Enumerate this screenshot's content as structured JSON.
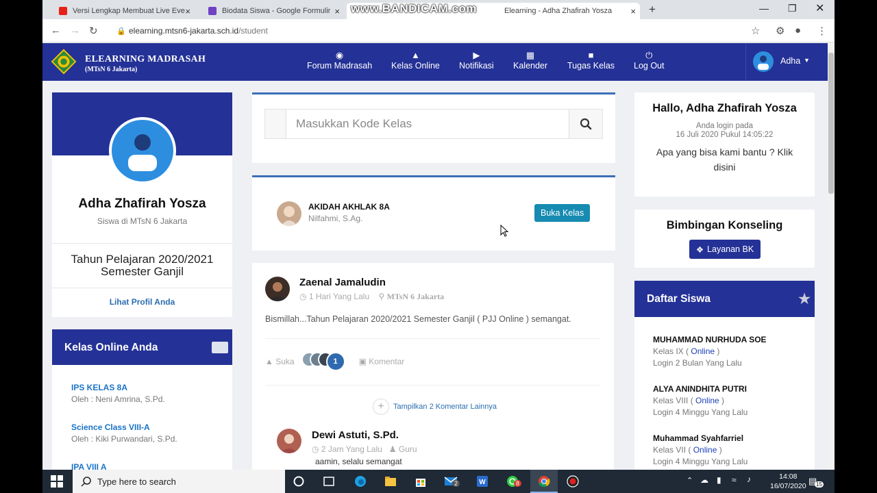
{
  "browser": {
    "tabs": [
      {
        "title": "Versi Lengkap Membuat Live Eve",
        "close": "×"
      },
      {
        "title": "Biodata Siswa - Google Formulir",
        "close": "×"
      },
      {
        "title": "Elearning - Adha Zhafirah Yosza",
        "close": "×"
      }
    ],
    "new_tab": "+",
    "watermark": "www.BANDICAM.com",
    "url_host": "elearning.mtsn6-jakarta.sch.id",
    "url_path": "/student"
  },
  "header": {
    "brand_title": "ELEARNING MADRASAH",
    "brand_sub": "(MTsN 6 Jakarta)",
    "menu": [
      {
        "label": "Forum Madrasah",
        "icon": "comments-icon"
      },
      {
        "label": "Kelas Online",
        "icon": "graduation-cap-icon"
      },
      {
        "label": "Notifikasi",
        "icon": "bullhorn-icon"
      },
      {
        "label": "Kalender",
        "icon": "calendar-icon"
      },
      {
        "label": "Tugas Kelas",
        "icon": "folder-open-icon"
      },
      {
        "label": "Log Out",
        "icon": "power-icon"
      }
    ],
    "user": "Adha"
  },
  "profile": {
    "name": "Adha Zhafirah Yosza",
    "role": "Siswa di MTsN 6 Jakarta",
    "year_line1": "Tahun Pelajaran 2020/2021",
    "year_line2": "Semester Ganjil",
    "link": "Lihat Profil Anda"
  },
  "kelas_online": {
    "title": "Kelas Online Anda",
    "items": [
      {
        "name": "IPS KELAS 8A",
        "teacher": "Oleh : Neni Amrina, S.Pd."
      },
      {
        "name": "Science Class VIII-A",
        "teacher": "Oleh : Kiki Purwandari, S.Pd."
      },
      {
        "name": "IPA VIII A",
        "teacher": ""
      }
    ]
  },
  "search": {
    "placeholder": "Masukkan Kode Kelas"
  },
  "class_card": {
    "name": "AKIDAH AKHLAK 8A",
    "teacher": "Nilfahmi, S.Ag.",
    "button": "Buka Kelas"
  },
  "post": {
    "author": "Zaenal Jamaludin",
    "time": "1 Hari Yang Lalu",
    "location": "MTsN 6 Jakarta",
    "text": "Bismillah...Tahun Pelajaran 2020/2021 Semester Ganjil ( PJJ Online ) semangat.",
    "like_label": "Suka",
    "like_count": "1",
    "comment_label": "Komentar",
    "more_comments": "Tampilkan 2 Komentar Lainnya",
    "comment": {
      "author": "Dewi Astuti, S.Pd.",
      "time": "2 Jam Yang Lalu",
      "role": "Guru",
      "text": "aamin, selalu semangat"
    }
  },
  "welcome": {
    "hallo": "Hallo, Adha Zhafirah Yosza",
    "login_line1": "Anda login pada",
    "login_line2": "16 Juli 2020 Pukul 14:05:22",
    "help": "Apa yang bisa kami bantu ? Klik disini"
  },
  "bk": {
    "title": "Bimbingan Konseling",
    "button": "Layanan BK"
  },
  "daftar_siswa": {
    "title": "Daftar Siswa",
    "students": [
      {
        "name": "MUHAMMAD NURHUDA SOE",
        "kelas": "Kelas IX (",
        "status": "Online",
        "close": " )",
        "login": "Login 2 Bulan Yang Lalu"
      },
      {
        "name": "ALYA ANINDHITA PUTRI",
        "kelas": "Kelas VIII (",
        "status": "Online",
        "close": " )",
        "login": "Login 4 Minggu Yang Lalu"
      },
      {
        "name": "Muhammad Syahfarriel",
        "kelas": "Kelas VII (",
        "status": "Online",
        "close": " )",
        "login": "Login 4 Minggu Yang Lalu"
      }
    ]
  },
  "taskbar": {
    "search_placeholder": "Type here to search",
    "time": "14:08",
    "date": "16/07/2020",
    "badge_mail": "2",
    "badge_whatsapp": "8",
    "badge_notif": "15"
  }
}
